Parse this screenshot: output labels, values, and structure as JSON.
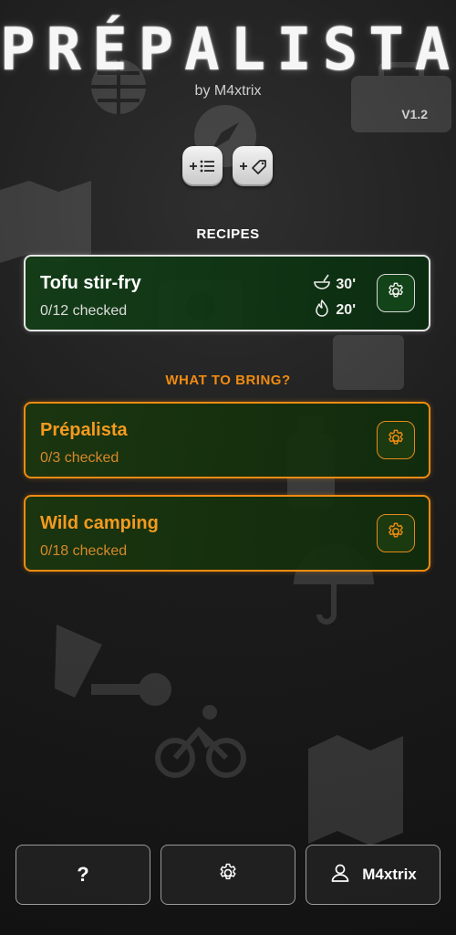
{
  "header": {
    "title": "PRÉPALISTA",
    "byline": "by M4xtrix",
    "version": "V1.2"
  },
  "actions": {
    "add_list_icon": "add-list-icon",
    "add_tag_icon": "add-tag-icon"
  },
  "recipes": {
    "section_title": "RECIPES",
    "items": [
      {
        "title": "Tofu stir-fry",
        "checked": "0/12 checked",
        "prep_time": "30'",
        "cook_time": "20'"
      }
    ]
  },
  "bring": {
    "section_title": "WHAT TO BRING?",
    "items": [
      {
        "title": "Prépalista",
        "checked": "0/3 checked"
      },
      {
        "title": "Wild camping",
        "checked": "0/18 checked"
      }
    ]
  },
  "bottom_bar": {
    "help_label": "?",
    "user_label": "M4xtrix"
  },
  "colors": {
    "accent_orange": "#f08b12",
    "card_green": "#123e16",
    "border_white": "#e5e5e5"
  }
}
